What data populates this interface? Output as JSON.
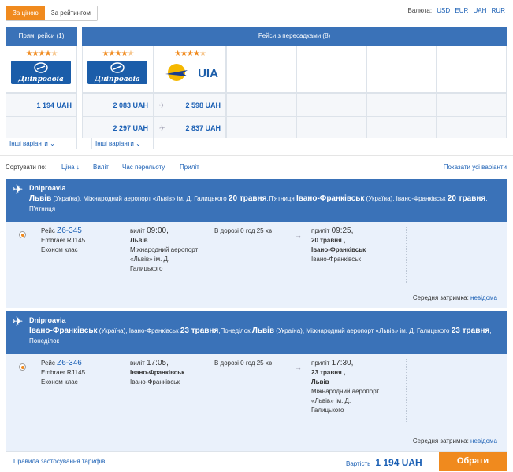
{
  "sort_toggle": {
    "by_price": "За ціною",
    "by_rating": "За рейтингом"
  },
  "currency": {
    "label": "Валюта:",
    "options": [
      "USD",
      "EUR",
      "UAH",
      "RUR"
    ]
  },
  "matrix": {
    "direct_header": "Прямі рейси (1)",
    "transfer_header": "Рейси з пересадками (8)",
    "airlines": [
      {
        "name": "Дніпроавіа",
        "stars": 4
      },
      {
        "name": "Дніпроавіа",
        "stars": 4
      },
      {
        "name": "UIA",
        "stars": 4
      }
    ],
    "direct_prices": [
      "1 194 UAH"
    ],
    "transfer_row1": [
      "2 083 UAH",
      "2 598 UAH"
    ],
    "transfer_row2": [
      "2 297 UAH",
      "2 837 UAH"
    ],
    "other_options": "Інші варіанти"
  },
  "sortbar": {
    "label": "Сортувати по:",
    "options": [
      "Ціна ↓",
      "Виліт",
      "Час перельоту",
      "Приліт"
    ],
    "show_all": "Показати усі варіанти"
  },
  "flights": [
    {
      "airline": "Dniproavia",
      "route_from": "Львів",
      "route_from_country": "(Україна), Міжнародний аеропорт «Львів» ім. Д. Галицького",
      "route_date": "20 травня",
      "route_day": ",П'ятниця",
      "route_to": "Івано-Франківськ",
      "route_to_country": "(Україна), Івано-Франківськ",
      "route_date2": "20 травня",
      "route_day2": ", П'ятниця",
      "flight_label": "Рейс",
      "flight_no": "Z6-345",
      "aircraft": "Embraer RJ145",
      "cabin": "Економ клас",
      "dep_label": "виліт",
      "dep_time": "09:00,",
      "dep_city": "Львів",
      "dep_airport": [
        "Міжнародний аеропорт",
        "«Львів» ім. Д.",
        "Галицького"
      ],
      "duration": "В дорозі 0 год 25 хв",
      "arr_label": "приліт",
      "arr_time": "09:25,",
      "arr_date": "20 травня ,",
      "arr_city": "Івано-Франківськ",
      "arr_airport": [
        "Івано-Франківськ"
      ],
      "delay_label": "Середня затримка:",
      "delay_value": "невідома"
    },
    {
      "airline": "Dniproavia",
      "route_from": "Івано-Франківськ",
      "route_from_country": "(Україна), Івано-Франківськ",
      "route_date": "23 травня",
      "route_day": ",Понеділок",
      "route_to": "Львів",
      "route_to_country": "(Україна), Міжнародний аеропорт «Львів» ім. Д. Галицького",
      "route_date2": "23 травня",
      "route_day2": ", Понеділок",
      "flight_label": "Рейс",
      "flight_no": "Z6-346",
      "aircraft": "Embraer RJ145",
      "cabin": "Економ клас",
      "dep_label": "виліт",
      "dep_time": "17:05,",
      "dep_city": "Івано-Франківськ",
      "dep_airport": [
        "Івано-Франківськ"
      ],
      "duration": "В дорозі 0 год 25 хв",
      "arr_label": "приліт",
      "arr_time": "17:30,",
      "arr_date": "23 травня ,",
      "arr_city": "Львів",
      "arr_airport": [
        "Міжнародний аеропорт",
        "«Львів» ім. Д.",
        "Галицького"
      ],
      "delay_label": "Середня затримка:",
      "delay_value": "невідома"
    }
  ],
  "footer": {
    "rules_link": "Правила застосування тарифів",
    "cost_label": "Вартість",
    "cost_value": "1 194 UAH",
    "select_button": "Обрати"
  },
  "colors": {
    "accent": "#f08a1e",
    "brand_blue": "#3a72b8",
    "link": "#1a5fb4",
    "panel": "#eaf1fb"
  }
}
